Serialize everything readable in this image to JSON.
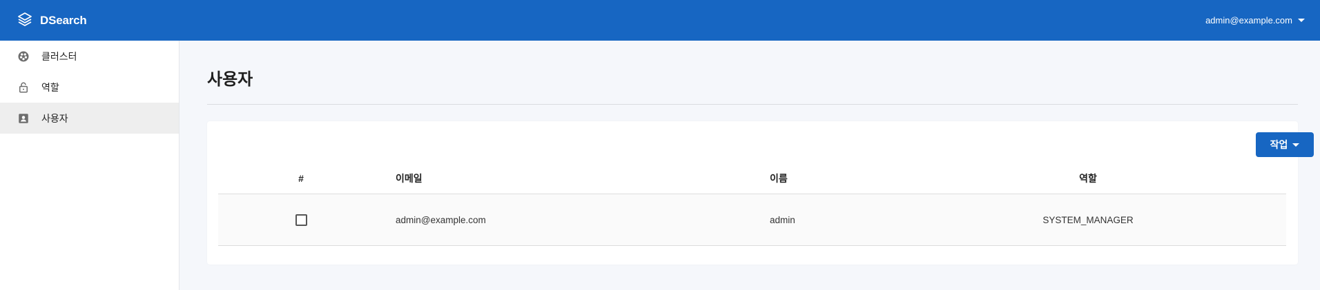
{
  "app": {
    "brand_icon": "layers-icon",
    "title": "DSearch",
    "user_email": "admin@example.com",
    "accent_color": "#1766c2"
  },
  "sidebar": {
    "items": [
      {
        "label": "클러스터",
        "icon": "cluster-icon",
        "active": false
      },
      {
        "label": "역할",
        "icon": "lock-icon",
        "active": false
      },
      {
        "label": "사용자",
        "icon": "account-box-icon",
        "active": true
      }
    ]
  },
  "main": {
    "page_title": "사용자",
    "action_button": "작업",
    "table": {
      "headers": {
        "num": "#",
        "email": "이메일",
        "name": "이름",
        "role": "역할"
      },
      "rows": [
        {
          "checked": false,
          "email": "admin@example.com",
          "name": "admin",
          "role": "SYSTEM_MANAGER"
        }
      ]
    }
  }
}
